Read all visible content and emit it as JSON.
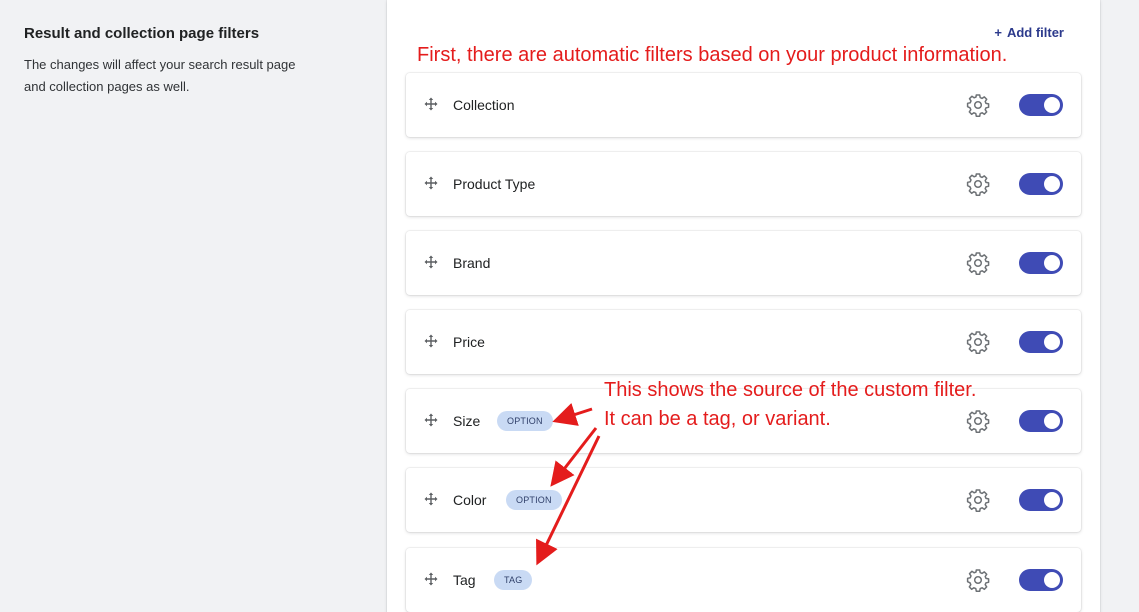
{
  "section": {
    "title": "Result and collection page filters",
    "description_line1": "The changes will affect your search result page",
    "description_line2": "and collection pages as well."
  },
  "card": {
    "add_filter_label": "Add filter"
  },
  "filters": [
    {
      "label": "Collection",
      "badge": "",
      "enabled": true
    },
    {
      "label": "Product Type",
      "badge": "",
      "enabled": true
    },
    {
      "label": "Brand",
      "badge": "",
      "enabled": true
    },
    {
      "label": "Price",
      "badge": "",
      "enabled": true
    },
    {
      "label": "Size",
      "badge": "OPTION",
      "enabled": true
    },
    {
      "label": "Color",
      "badge": "OPTION",
      "enabled": true
    },
    {
      "label": "Tag",
      "badge": "TAG",
      "enabled": true
    }
  ],
  "annotations": {
    "top": "First, there are automatic filters based on your product information.",
    "source_line1": "This shows the source of the custom filter.",
    "source_line2": "It can be a tag, or variant."
  },
  "colors": {
    "toggle_on": "#3f4bb5",
    "badge_bg": "#c9daf4",
    "annotation": "#e41c1c",
    "add_filter": "#2c3a8c"
  },
  "icons": {
    "drag": "drag-handle-icon",
    "settings": "gear-icon",
    "add": "plus-icon"
  }
}
